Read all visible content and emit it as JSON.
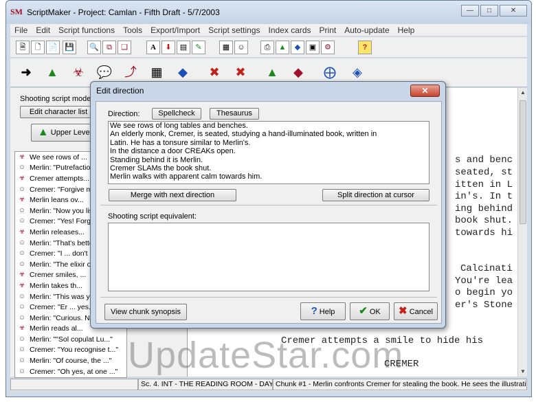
{
  "window": {
    "logo": "SM",
    "title": "ScriptMaker - Project: Camlan - Fifth Draft - 5/7/2003",
    "controls": [
      "minimize-icon",
      "maximize-icon",
      "close-icon"
    ]
  },
  "menu": [
    "File",
    "Edit",
    "Script functions",
    "Tools",
    "Export/Import",
    "Script settings",
    "Index cards",
    "Print",
    "Auto-update",
    "Help"
  ],
  "left_panel": {
    "mode_label": "Shooting script mode",
    "edit_character_list": "Edit character list",
    "upper_level": "Upper Level"
  },
  "chunk_list": [
    {
      "type": "direction",
      "text": "We see rows of ..."
    },
    {
      "type": "dialogue",
      "text": "Merlin: \"Putrefaction..."
    },
    {
      "type": "direction",
      "text": "Cremer attempts..."
    },
    {
      "type": "dialogue",
      "text": "Cremer: \"Forgive me..."
    },
    {
      "type": "direction",
      "text": "Merlin leans ov..."
    },
    {
      "type": "dialogue",
      "text": "Merlin: \"Now you list..."
    },
    {
      "type": "dialogue",
      "text": "Cremer: \"Yes! Forgive..."
    },
    {
      "type": "direction",
      "text": "Merlin releases..."
    },
    {
      "type": "dialogue",
      "text": "Merlin: \"That's better..."
    },
    {
      "type": "dialogue",
      "text": "Cremer: \"I ... don't kn..."
    },
    {
      "type": "dialogue",
      "text": "Merlin: \"The elixir of..."
    },
    {
      "type": "direction",
      "text": "Cremer smiles, ..."
    },
    {
      "type": "direction",
      "text": "Merlin takes th..."
    },
    {
      "type": "dialogue",
      "text": "Merlin: \"This was yo..."
    },
    {
      "type": "dialogue",
      "text": "Cremer: \"Er ... yes...."
    },
    {
      "type": "dialogue",
      "text": "Merlin: \"Curious. Not..."
    },
    {
      "type": "direction",
      "text": "Merlin reads al..."
    },
    {
      "type": "dialogue",
      "text": "Merlin: \"\"Sol copulat Lu...\""
    },
    {
      "type": "dialogue",
      "text": "Cremer: \"You recognise t...\""
    },
    {
      "type": "dialogue",
      "text": "Merlin: \"Of course, the ...\""
    },
    {
      "type": "dialogue",
      "text": "Cremer: \"Oh yes, at one ...\""
    }
  ],
  "script_text": [
    "s and benc",
    "seated, st",
    "itten in L",
    "in's. In t",
    "ing behind",
    "book shut.",
    "towards hi",
    "Calcinati",
    "You're lea",
    "o begin yo",
    "er's Stone",
    "Cremer attempts a smile to hide his",
    "CREMER"
  ],
  "status": {
    "scene": "Sc. 4. INT - THE READING ROOM - DAY",
    "chunk": "Chunk #1 - Merlin confronts Cremer for stealing the book. He sees the illustrati"
  },
  "watermark": "UpdateStar.com",
  "dialog": {
    "title": "Edit direction",
    "direction_label": "Direction:",
    "spellcheck": "Spellcheck",
    "thesaurus": "Thesaurus",
    "direction_lines": [
      "We see rows of long tables and benches.",
      "An elderly monk, Cremer, is seated, studying a hand-illuminated book, written in",
      "Latin. He has a tonsure similar to Merlin's.",
      "In the distance a door CREAKs open.",
      "Standing behind it is Merlin.",
      "Cremer SLAMs the book shut.",
      "Merlin walks with apparent calm towards him."
    ],
    "merge_button": "Merge with next direction",
    "split_button": "Split direction at cursor",
    "shooting_label": "Shooting script equivalent:",
    "shooting_text": "",
    "view_synopsis": "View chunk synopsis",
    "help": "Help",
    "ok": "OK",
    "cancel": "Cancel"
  }
}
